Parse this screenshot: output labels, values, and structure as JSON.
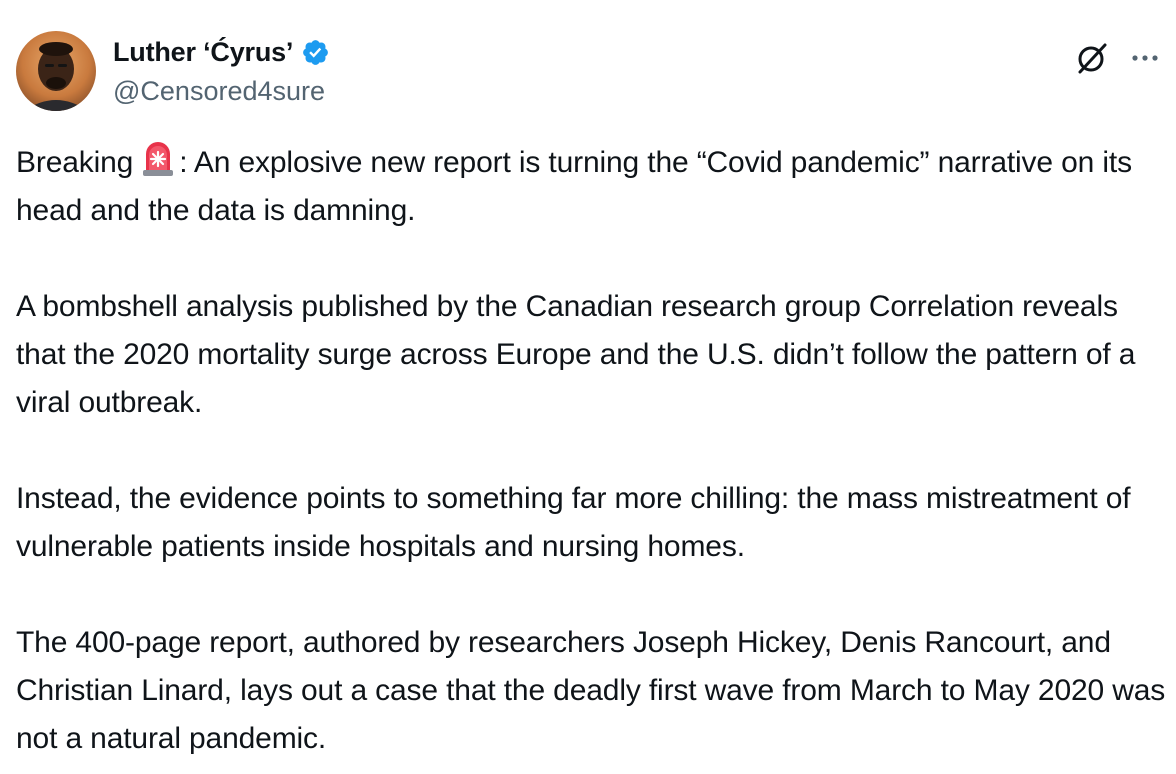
{
  "author": {
    "display_name": "Luther ‘Ćyrus’",
    "handle": "@Censored4sure",
    "verified_color": "#1d9bf0"
  },
  "icons": {
    "verified": "verified-badge-icon",
    "grok": "grok-icon",
    "more": "more-options-icon",
    "emoji": "police-car-light-emoji"
  },
  "post": {
    "para1_before_emoji": "Breaking",
    "para1_after_emoji": ": An explosive new report is turning the “Covid pandemic” narrative on its head and the data is damning.",
    "para2": "A bombshell analysis published by the Canadian research group Correlation reveals that the 2020 mortality surge across Europe and the U.S. didn’t follow the pattern of a viral outbreak.",
    "para3": "Instead, the evidence points to something far more chilling: the mass mistreatment of vulnerable patients inside hospitals and nursing homes.",
    "para4": "The 400-page report, authored by researchers Joseph Hickey, Denis Rancourt, and Christian Linard, lays out a case that the deadly first wave from March to May 2020 was not a natural pandemic."
  }
}
